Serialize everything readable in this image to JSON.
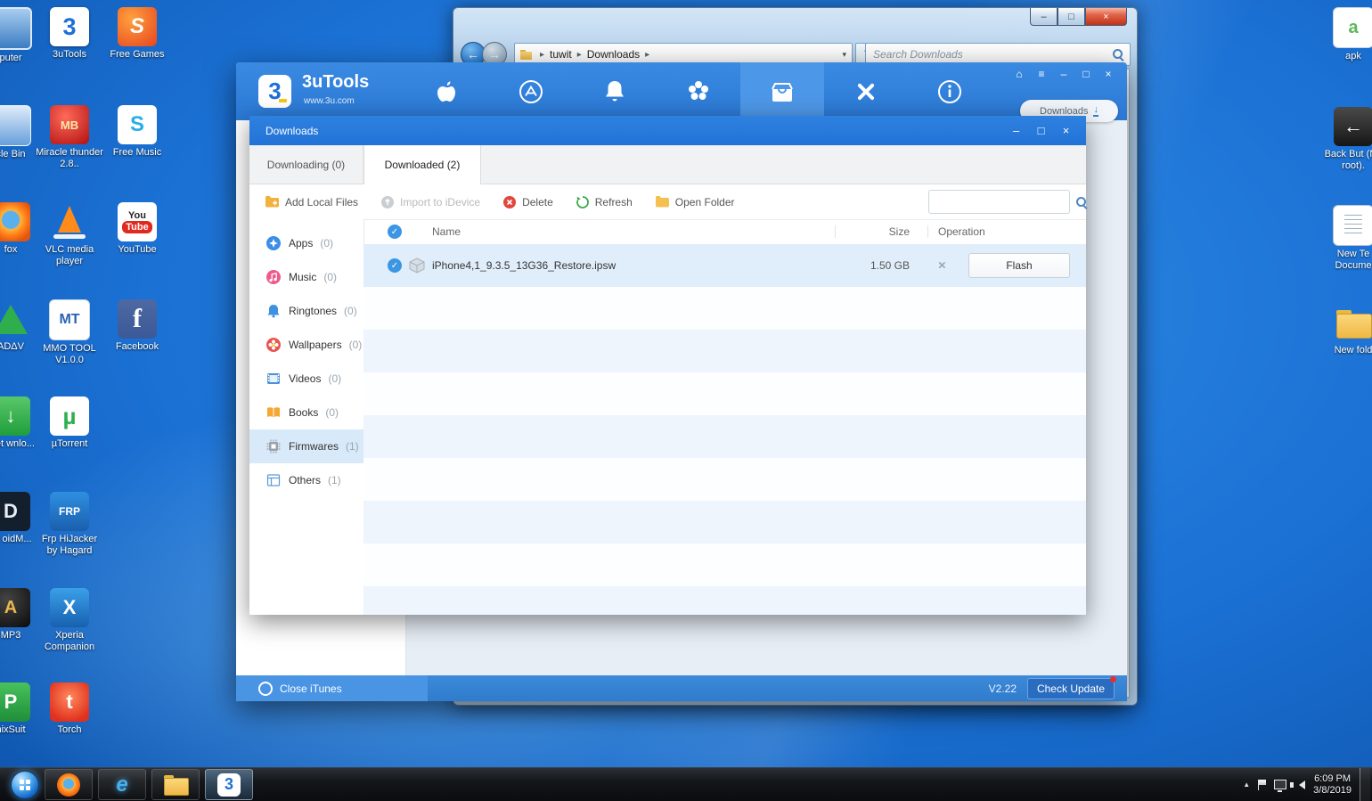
{
  "desktop": {
    "left_icons": [
      {
        "label": "puter"
      },
      {
        "label": "3uTools"
      },
      {
        "label": "Free Games"
      },
      {
        "label": "cle Bin"
      },
      {
        "label": "Miracle thunder 2.8.."
      },
      {
        "label": "Free Music"
      },
      {
        "label": "fox"
      },
      {
        "label": "VLC media player"
      },
      {
        "label": "YouTube"
      },
      {
        "label": "ADΔV"
      },
      {
        "label": "MMO TOOL V1.0.0"
      },
      {
        "label": "Facebook"
      },
      {
        "label": "rnet wnlo..."
      },
      {
        "label": "µTorrent"
      },
      {
        "label": "ck oidM..."
      },
      {
        "label": "Frp HiJacker by Hagard"
      },
      {
        "label": "MP3"
      },
      {
        "label": "Xperia Companion"
      },
      {
        "label": "nixSuit"
      },
      {
        "label": "Torch"
      }
    ],
    "right_icons": [
      {
        "label": "apk"
      },
      {
        "label": "Back But (No root)."
      },
      {
        "label": "New Te Docume"
      },
      {
        "label": "New fold"
      }
    ]
  },
  "explorer": {
    "breadcrumb": {
      "root": "tuwit",
      "folder": "Downloads"
    },
    "search_placeholder": "Search Downloads"
  },
  "app": {
    "title": "3uTools",
    "subtitle": "www.3u.com",
    "logo_glyph": "3",
    "nav_icons": [
      "idevice",
      "appstore",
      "notifications",
      "wallpapers",
      "downloads",
      "toolbox",
      "info"
    ],
    "downloads_button_label": "Downloads",
    "status": {
      "close_itunes": "Close iTunes",
      "version": "V2.22",
      "check_update": "Check Update"
    }
  },
  "dialog": {
    "title": "Downloads",
    "tabs": [
      {
        "label": "Downloading (0)"
      },
      {
        "label": "Downloaded (2)"
      }
    ],
    "toolbar": {
      "add_local_files": "Add Local Files",
      "import_to_idevice": "Import to iDevice",
      "delete": "Delete",
      "refresh": "Refresh",
      "open_folder": "Open Folder",
      "search_value": ""
    },
    "sidebar": [
      {
        "label": "Apps",
        "count": "(0)"
      },
      {
        "label": "Music",
        "count": "(0)"
      },
      {
        "label": "Ringtones",
        "count": "(0)"
      },
      {
        "label": "Wallpapers",
        "count": "(0)"
      },
      {
        "label": "Videos",
        "count": "(0)"
      },
      {
        "label": "Books",
        "count": "(0)"
      },
      {
        "label": "Firmwares",
        "count": "(1)"
      },
      {
        "label": "Others",
        "count": "(1)"
      }
    ],
    "table": {
      "headers": {
        "name": "Name",
        "size": "Size",
        "operation": "Operation"
      },
      "rows": [
        {
          "name": "iPhone4,1_9.3.5_13G36_Restore.ipsw",
          "size": "1.50 GB",
          "action": "Flash"
        }
      ]
    }
  },
  "taskbar": {
    "clock": {
      "time": "6:09 PM",
      "date": "3/8/2019"
    }
  },
  "glyphs": {
    "back_arrow": "←",
    "forward_arrow": "→",
    "chevron": "▸",
    "dropdown": "▾",
    "refresh": "↻",
    "home": "⌂",
    "menu": "≡",
    "minimize": "–",
    "maximize": "□",
    "restore": "□",
    "close": "×",
    "check": "✓",
    "remove": "×",
    "download_arrow": "↓",
    "tray_expand": "▲"
  },
  "colors": {
    "header_blue": "#2e7dd8",
    "dialog_title_blue": "#2577dd",
    "accent_blue": "#3b97e3",
    "notification_red": "#e8302a"
  }
}
